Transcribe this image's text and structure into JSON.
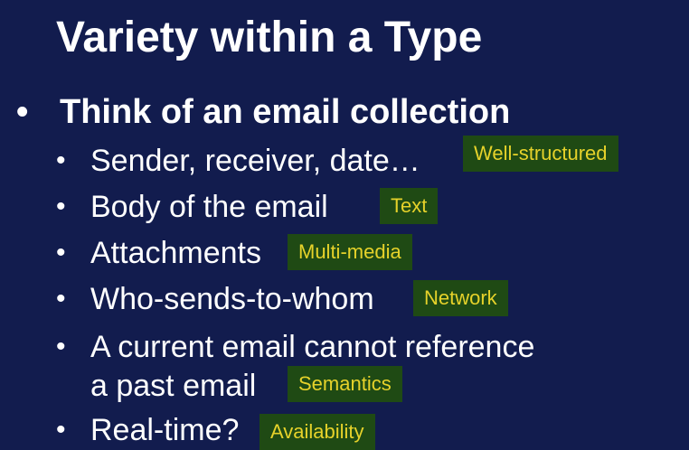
{
  "slide": {
    "title": "Variety within a Type",
    "main_bullet": "Think of an email collection",
    "bullet_glyph": "•",
    "items": [
      {
        "text": "Sender, receiver, date…",
        "tag": "Well-structured"
      },
      {
        "text": "Body of the email",
        "tag": "Text"
      },
      {
        "text": "Attachments",
        "tag": "Multi-media"
      },
      {
        "text": "Who-sends-to-whom",
        "tag": "Network"
      },
      {
        "text": "A current email cannot reference",
        "text2": "a past email",
        "tag": "Semantics"
      },
      {
        "text": "Real-time?",
        "tag": "Availability"
      }
    ]
  },
  "colors": {
    "background": "#121c4e",
    "tag_background": "#1f4a14",
    "tag_text": "#e6d22a"
  }
}
